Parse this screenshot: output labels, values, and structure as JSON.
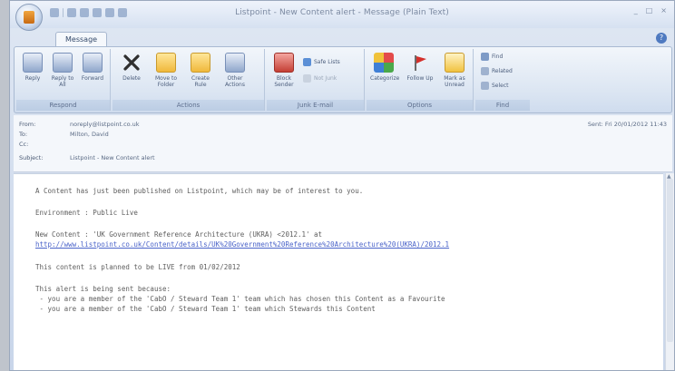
{
  "window": {
    "title": "Listpoint - New Content alert - Message (Plain Text)",
    "controls": [
      "_",
      "□",
      "×"
    ]
  },
  "ribbon": {
    "tab": "Message",
    "groups": [
      {
        "label": "Respond",
        "buttons": [
          "Reply",
          "Reply to All",
          "Forward"
        ]
      },
      {
        "label": "Actions",
        "buttons": [
          "Delete",
          "Move to Folder",
          "Create Rule",
          "Other Actions"
        ]
      },
      {
        "label": "Junk E-mail",
        "buttons": [
          "Block Sender"
        ],
        "small": [
          "Safe Lists",
          "Not Junk"
        ]
      },
      {
        "label": "Options",
        "buttons": [
          "Categorize",
          "Follow Up",
          "Mark as Unread"
        ]
      },
      {
        "label": "Find",
        "small": [
          "Find",
          "Related",
          "Select"
        ]
      }
    ]
  },
  "header": {
    "from_label": "From:",
    "from": "noreply@listpoint.co.uk",
    "to_label": "To:",
    "to": "Milton, David",
    "cc_label": "Cc:",
    "cc": "",
    "subject_label": "Subject:",
    "subject": "Listpoint - New Content alert",
    "sent": "Sent: Fri 20/01/2012 11:43"
  },
  "body": {
    "line1": "A Content has just been published on Listpoint, which may be of interest to you.",
    "line2": "Environment : Public Live",
    "line3": "New Content : 'UK Government Reference Architecture (UKRA) <2012.1' at",
    "link": "http://www.listpoint.co.uk/Content/details/UK%20Government%20Reference%20Architecture%20(UKRA)/2012.1",
    "line4": "This content is planned to be LIVE from 01/02/2012",
    "line5": "This alert is being sent because:",
    "bullet1": " - you are a member of the 'CabO / Steward Team 1' team which has chosen this Content as a Favourite",
    "bullet2": " - you are a member of the 'CabO / Steward Team 1' team which Stewards this Content"
  },
  "colors": {
    "ribbon_bg": "#dbe5f2",
    "link": "#4a63c9",
    "body_text": "#5e5e5e"
  }
}
